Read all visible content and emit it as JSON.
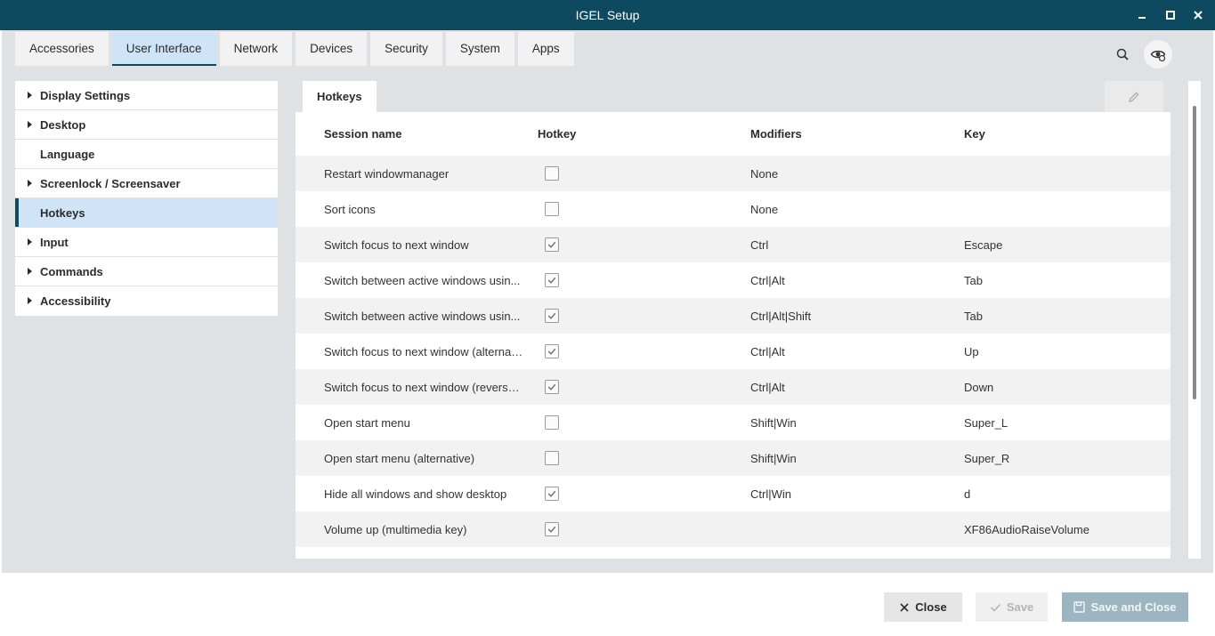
{
  "window": {
    "title": "IGEL Setup",
    "icons": {
      "minimize": "minimize-icon",
      "maximize": "maximize-icon",
      "close": "close-icon"
    }
  },
  "tabs": [
    {
      "label": "Accessories",
      "active": false
    },
    {
      "label": "User Interface",
      "active": true
    },
    {
      "label": "Network",
      "active": false
    },
    {
      "label": "Devices",
      "active": false
    },
    {
      "label": "Security",
      "active": false
    },
    {
      "label": "System",
      "active": false
    },
    {
      "label": "Apps",
      "active": false
    }
  ],
  "toolbar_icons": {
    "search": "search-icon",
    "visibility": "eye-settings-icon"
  },
  "sidebar": {
    "items": [
      {
        "label": "Display Settings",
        "expandable": true,
        "selected": false
      },
      {
        "label": "Desktop",
        "expandable": true,
        "selected": false
      },
      {
        "label": "Language",
        "expandable": false,
        "selected": false
      },
      {
        "label": "Screenlock / Screensaver",
        "expandable": true,
        "selected": false
      },
      {
        "label": "Hotkeys",
        "expandable": false,
        "selected": true
      },
      {
        "label": "Input",
        "expandable": true,
        "selected": false
      },
      {
        "label": "Commands",
        "expandable": true,
        "selected": false
      },
      {
        "label": "Accessibility",
        "expandable": true,
        "selected": false
      }
    ]
  },
  "content": {
    "tab_label": "Hotkeys",
    "edit_icon": "pencil-icon",
    "columns": [
      "Session name",
      "Hotkey",
      "Modifiers",
      "Key"
    ],
    "rows": [
      {
        "session": "Restart windowmanager",
        "hotkey": false,
        "modifiers": "None",
        "key": ""
      },
      {
        "session": "Sort icons",
        "hotkey": false,
        "modifiers": "None",
        "key": ""
      },
      {
        "session": "Switch focus to next window",
        "hotkey": true,
        "modifiers": "Ctrl",
        "key": "Escape"
      },
      {
        "session": "Switch between active windows usin...",
        "hotkey": true,
        "modifiers": "Ctrl|Alt",
        "key": "Tab"
      },
      {
        "session": "Switch between active windows usin...",
        "hotkey": true,
        "modifiers": "Ctrl|Alt|Shift",
        "key": "Tab"
      },
      {
        "session": "Switch focus to next window (alternati...",
        "hotkey": true,
        "modifiers": "Ctrl|Alt",
        "key": "Up"
      },
      {
        "session": "Switch focus to next window (reverse ...",
        "hotkey": true,
        "modifiers": "Ctrl|Alt",
        "key": "Down"
      },
      {
        "session": "Open start menu",
        "hotkey": false,
        "modifiers": "Shift|Win",
        "key": "Super_L"
      },
      {
        "session": "Open start menu (alternative)",
        "hotkey": false,
        "modifiers": "Shift|Win",
        "key": "Super_R"
      },
      {
        "session": "Hide all windows and show desktop",
        "hotkey": true,
        "modifiers": "Ctrl|Win",
        "key": "d"
      },
      {
        "session": "Volume up (multimedia key)",
        "hotkey": true,
        "modifiers": "",
        "key": "XF86AudioRaiseVolume"
      }
    ]
  },
  "footer": {
    "close_label": "Close",
    "save_label": "Save",
    "save_close_label": "Save and Close"
  },
  "colors": {
    "titlebar": "#0e4a5f",
    "accent": "#0e4a5f",
    "selected_bg": "#cfe5f7",
    "panel_bg": "#dfe2e4",
    "save_close_bg": "#9db5c0"
  }
}
